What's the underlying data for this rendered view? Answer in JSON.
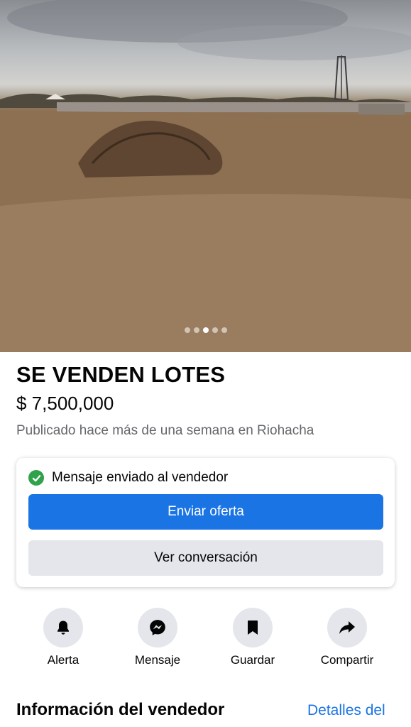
{
  "listing": {
    "title": "SE VENDEN LOTES",
    "price": "$ 7,500,000",
    "meta": "Publicado hace más de una semana en Riohacha"
  },
  "carousel": {
    "total": 5,
    "active_index": 2
  },
  "status_card": {
    "sent_text": "Mensaje enviado al vendedor",
    "offer_button": "Enviar oferta",
    "conversation_button": "Ver conversación"
  },
  "actions": [
    {
      "label": "Alerta",
      "icon": "bell-icon"
    },
    {
      "label": "Mensaje",
      "icon": "messenger-icon"
    },
    {
      "label": "Guardar",
      "icon": "bookmark-icon"
    },
    {
      "label": "Compartir",
      "icon": "share-icon"
    }
  ],
  "seller": {
    "section_title": "Información del vendedor",
    "details_link": "Detalles del"
  },
  "colors": {
    "accent": "#1b74e4",
    "success": "#31a24c",
    "secondary_bg": "#e4e6eb",
    "muted_text": "#65676b"
  }
}
